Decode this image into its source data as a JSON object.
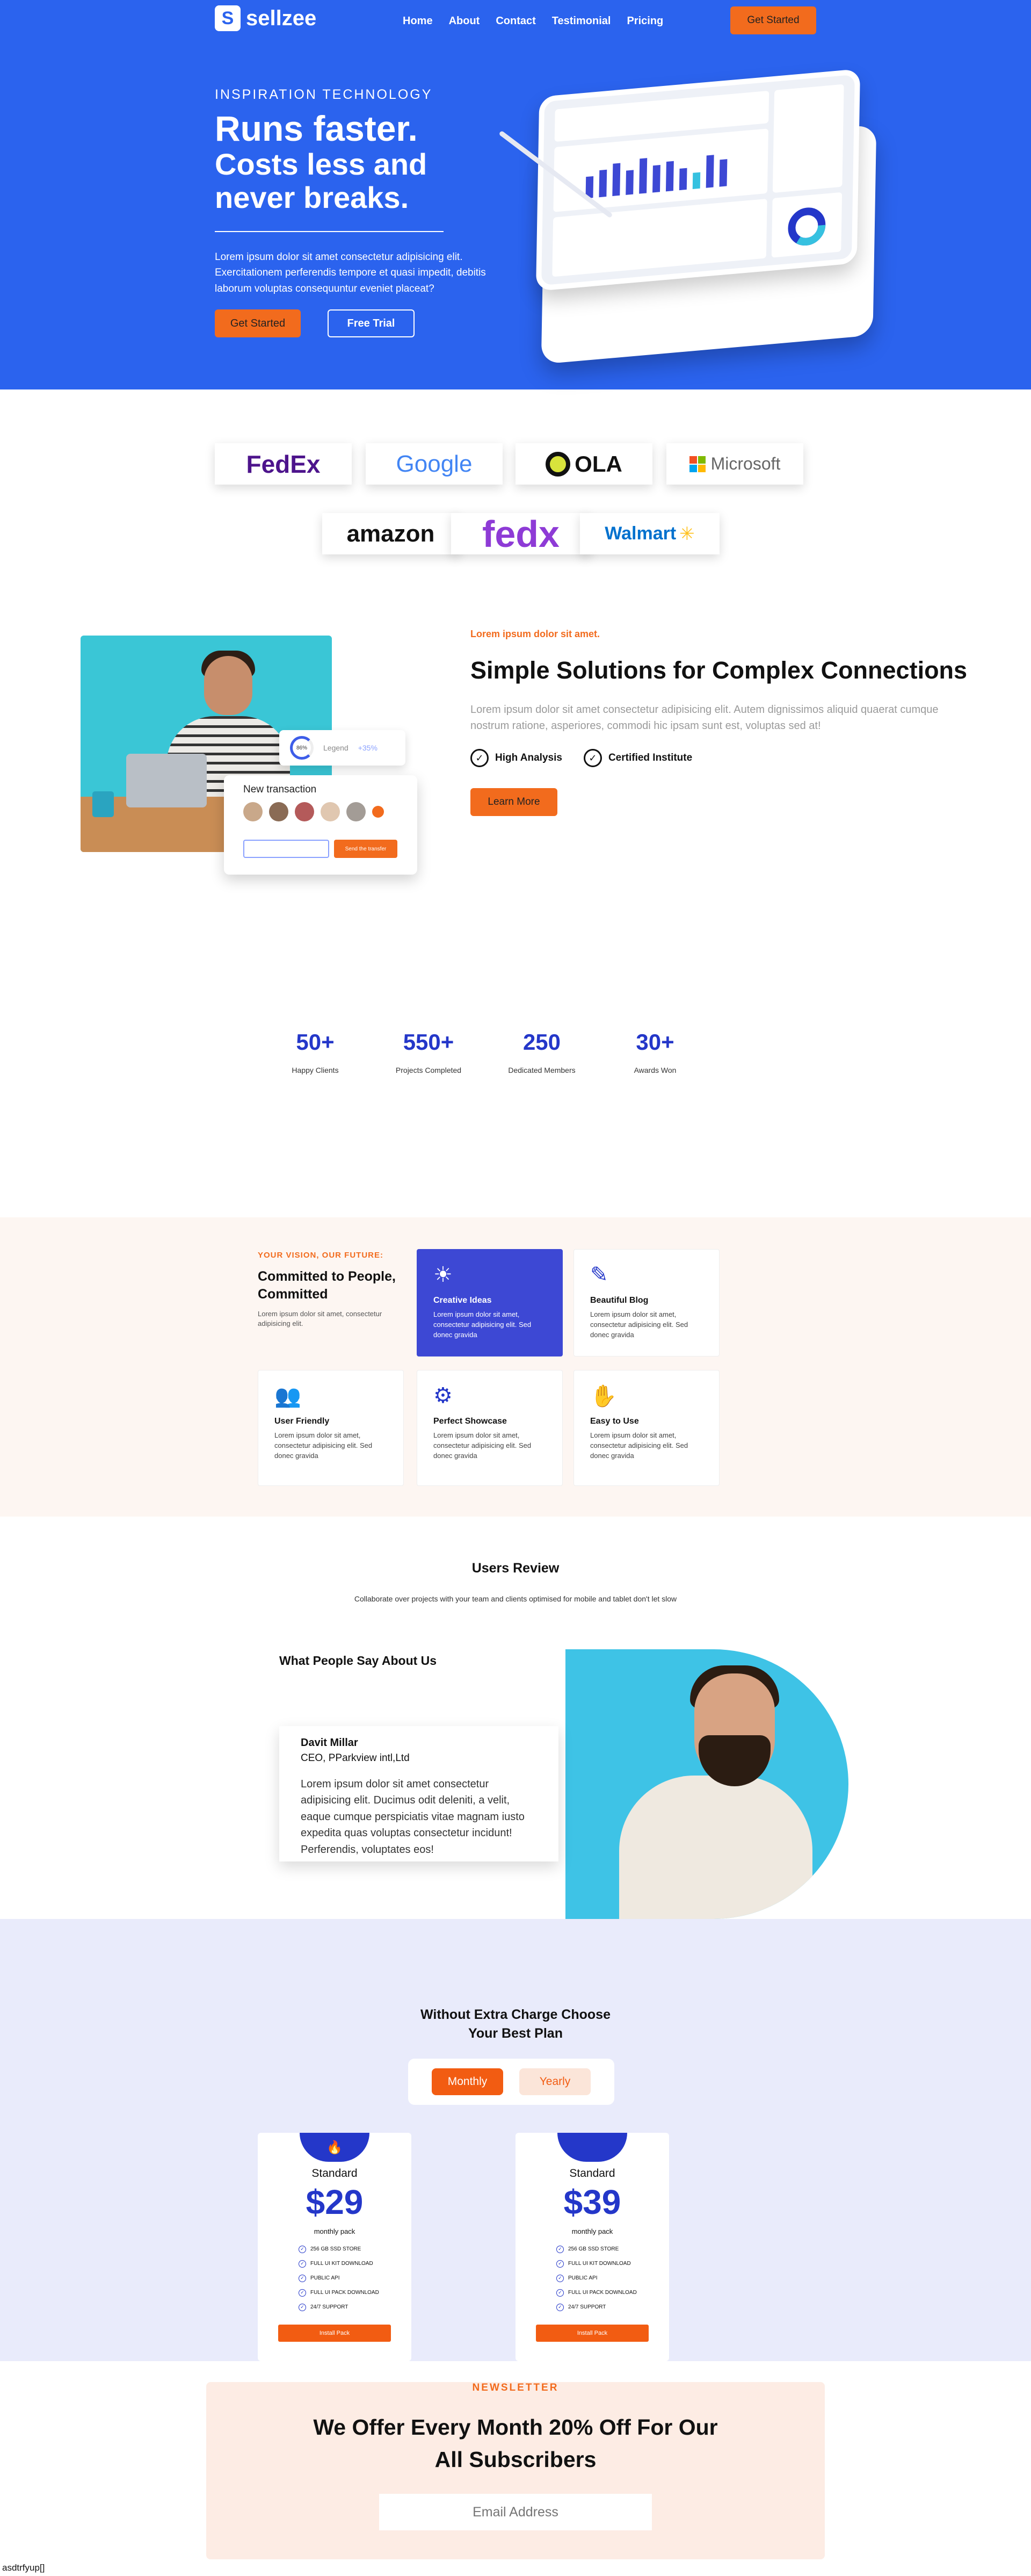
{
  "brand": {
    "name": "sellzee",
    "mark": "S"
  },
  "nav": {
    "links": [
      "Home",
      "About",
      "Contact",
      "Testimonial",
      "Pricing"
    ],
    "cta": "Get Started"
  },
  "hero": {
    "eyebrow": "INSPIRATION TECHNOLOGY",
    "title_line1": "Runs faster.",
    "title_line2": "Costs less and",
    "title_line3": "never breaks.",
    "description": "Lorem ipsum dolor sit amet consectetur adipisicing elit. Exercitationem perferendis tempore et quasi impedit, debitis laborum voluptas consequuntur eveniet placeat?",
    "primary_button": "Get Started",
    "secondary_button": "Free Trial"
  },
  "partners": [
    "FedEx",
    "Google",
    "OLA",
    "Microsoft",
    "amazon",
    "fedx",
    "Walmart"
  ],
  "about": {
    "eyebrow": "Lorem ipsum dolor sit amet.",
    "title": "Simple Solutions for Complex Connections",
    "description": "Lorem ipsum dolor sit amet consectetur adipisicing elit. Autem dignissimos aliquid quaerat cumque nostrum ratione, asperiores, commodi hic ipsam sunt est, voluptas sed at!",
    "checks": [
      "High Analysis",
      "Certified Institute"
    ],
    "button": "Learn More",
    "legend_card": {
      "percent": "86%",
      "label": "Legend",
      "change": "+35%"
    },
    "transaction_card": {
      "title": "New transaction",
      "send": "Send the transfer"
    }
  },
  "stats": [
    {
      "value": "50+",
      "label": "Happy  Clients"
    },
    {
      "value": "550+",
      "label": "Projects Completed"
    },
    {
      "value": "250",
      "label": "Dedicated Members"
    },
    {
      "value": "30+",
      "label": "Awards Won"
    }
  ],
  "features": {
    "eyebrow": "YOUR VISION, OUR FUTURE:",
    "title": "Committed to People, Committed",
    "description": "Lorem ipsum dolor sit amet, consectetur adipisicing elit.",
    "cards": [
      {
        "title": "Creative Ideas",
        "text": "Lorem ipsum dolor sit amet, consectetur adipisicing elit. Sed donec gravida",
        "icon": "lightbulb-icon"
      },
      {
        "title": "Beautiful Blog",
        "text": "Lorem ipsum dolor sit amet, consectetur adipisicing elit. Sed donec gravida",
        "icon": "pencil-icon"
      },
      {
        "title": "User Friendly",
        "text": "Lorem ipsum dolor sit amet, consectetur adipisicing elit. Sed donec gravida",
        "icon": "users-icon"
      },
      {
        "title": "Perfect Showcase",
        "text": "Lorem ipsum dolor sit amet, consectetur adipisicing elit. Sed donec gravida",
        "icon": "gear-icon"
      },
      {
        "title": "Easy to Use",
        "text": "Lorem ipsum dolor sit amet, consectetur adipisicing elit. Sed donec gravida",
        "icon": "hand-icon"
      }
    ]
  },
  "reviews": {
    "title": "Users Review",
    "subtitle": "Collaborate over projects with your team and clients optimised for mobile and tablet don't let slow",
    "heading": "What People Say About Us",
    "name": "Davit Millar",
    "role": "CEO, PParkview intl,Ltd",
    "text": "Lorem ipsum dolor sit amet consectetur adipisicing elit. Ducimus odit deleniti, a velit, eaque cumque perspiciatis vitae magnam iusto expedita quas voluptas consectetur incidunt! Perferendis, voluptates eos!"
  },
  "pricing": {
    "title_line1": "Without Extra Charge Choose",
    "title_line2": "Your Best Plan",
    "toggle": [
      "Monthly",
      "Yearly"
    ],
    "plans": [
      {
        "name": "Standard",
        "price": "$29",
        "period": "monthly pack",
        "features": [
          "256 GB SSD STORE",
          "FULL UI KIT DOWNLOAD",
          "PUBLIC API",
          "FULL UI PACK DOWNLOAD",
          "24/7 SUPPORT"
        ],
        "button": "Install Pack"
      },
      {
        "name": "Standard",
        "price": "$39",
        "period": "monthly pack",
        "features": [
          "256 GB SSD STORE",
          "FULL UI KIT DOWNLOAD",
          "PUBLIC API",
          "FULL UI PACK DOWNLOAD",
          "24/7 SUPPORT"
        ],
        "button": "Install Pack"
      }
    ]
  },
  "newsletter": {
    "eyebrow": "NEWSLETTER",
    "title_line1": "We Offer Every Month 20% Off For Our",
    "title_line2": "All Subscribers",
    "placeholder": "Email Address"
  },
  "footer": {
    "text": "asdtrfyup[]"
  },
  "colors": {
    "primary": "#2b63ee",
    "accent": "#f26b1d",
    "deep_blue": "#2437c9"
  }
}
